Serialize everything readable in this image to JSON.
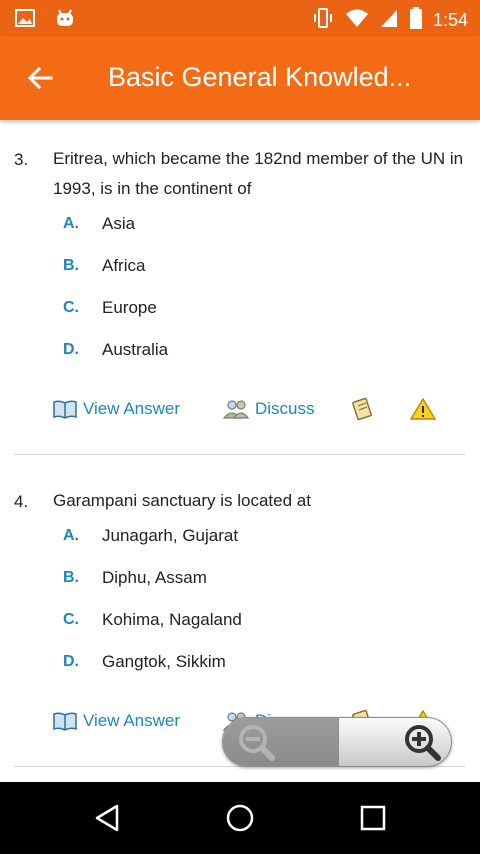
{
  "status_bar": {
    "time": "1:54",
    "left_icons": [
      "image-icon",
      "android-icon"
    ],
    "right_icons": [
      "vibrate-icon",
      "wifi-icon",
      "signal-icon",
      "battery-icon"
    ]
  },
  "app_bar": {
    "title": "Basic General Knowled..."
  },
  "questions": [
    {
      "number": "3.",
      "text": "Eritrea, which became the 182nd member of the UN in 1993, is in the continent of",
      "options": [
        {
          "letter": "A.",
          "text": "Asia"
        },
        {
          "letter": "B.",
          "text": "Africa"
        },
        {
          "letter": "C.",
          "text": "Europe"
        },
        {
          "letter": "D.",
          "text": "Australia"
        }
      ],
      "actions": {
        "view_answer": "View Answer",
        "discuss": "Discuss"
      }
    },
    {
      "number": "4.",
      "text": "Garampani sanctuary is located at",
      "options": [
        {
          "letter": "A.",
          "text": "Junagarh, Gujarat"
        },
        {
          "letter": "B.",
          "text": "Diphu, Assam"
        },
        {
          "letter": "C.",
          "text": "Kohima, Nagaland"
        },
        {
          "letter": "D.",
          "text": "Gangtok, Sikkim"
        }
      ],
      "actions": {
        "view_answer": "View Answer",
        "discuss": "Discuss"
      }
    }
  ],
  "colors": {
    "status_bar": "#ea6413",
    "app_bar": "#f46b16",
    "link_blue": "#1b87c0"
  }
}
